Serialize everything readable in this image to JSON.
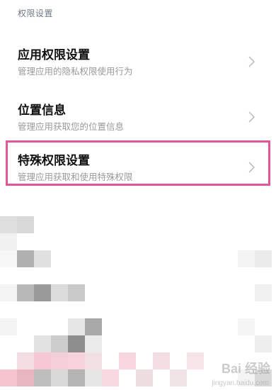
{
  "section": {
    "header": "权限设置"
  },
  "items": [
    {
      "title": "应用权限设置",
      "subtitle": "管理应用的隐私权限使用行为",
      "icon": "chevron-right-icon"
    },
    {
      "title": "位置信息",
      "subtitle": "管理应用获取您的位置信息",
      "icon": "chevron-right-icon"
    },
    {
      "title": "特殊权限设置",
      "subtitle": "管理应用获取和使用特殊权限",
      "icon": "chevron-right-icon"
    }
  ],
  "highlight": {
    "color": "#e0589a"
  },
  "watermark": {
    "text": "Bai 经验",
    "sub": "jingyan.baidu.com"
  }
}
